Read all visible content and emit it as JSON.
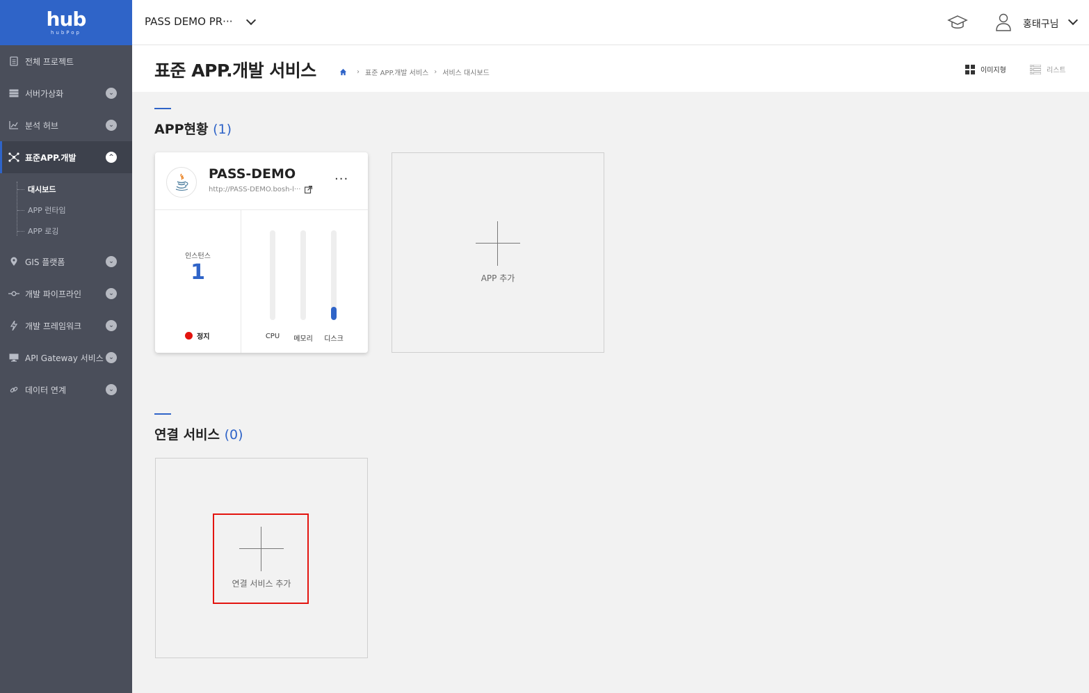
{
  "brand": {
    "logo": "hub",
    "logo_sub": "hubPop",
    "color": "#2f64c8"
  },
  "sidebar": {
    "items": [
      {
        "label": "전체 프로젝트",
        "icon": "document-icon",
        "expandable": false
      },
      {
        "label": "서버가상화",
        "icon": "server-icon",
        "expandable": true
      },
      {
        "label": "분석 허브",
        "icon": "chart-icon",
        "expandable": true
      },
      {
        "label": "표준APP.개발",
        "icon": "network-icon",
        "expandable": true,
        "active": true
      },
      {
        "label": "GIS 플랫폼",
        "icon": "map-pin-icon",
        "expandable": true
      },
      {
        "label": "개발 파이프라인",
        "icon": "pipeline-icon",
        "expandable": true
      },
      {
        "label": "개발 프레임워크",
        "icon": "lightning-icon",
        "expandable": true
      },
      {
        "label": "API Gateway 서비스",
        "icon": "monitor-icon",
        "expandable": true
      },
      {
        "label": "데이터 연계",
        "icon": "link-icon",
        "expandable": true
      }
    ],
    "subitems": [
      {
        "label": "대시보드",
        "active": true
      },
      {
        "label": "APP 런타임"
      },
      {
        "label": "APP 로깅"
      }
    ]
  },
  "topbar": {
    "project": "PASS DEMO PR···",
    "user_name": "홍태구님"
  },
  "titlebar": {
    "title": "표준 APP.개발 서비스",
    "breadcrumb": [
      "표준 APP.개발 서비스",
      "서비스 대시보드"
    ],
    "view_image": "이미지형",
    "view_list": "리스트"
  },
  "app_section": {
    "title": "APP현황",
    "count": "(1)",
    "app": {
      "name": "PASS-DEMO",
      "url": "http://PASS-DEMO.bosh-l···",
      "instance_label": "인스턴스",
      "instances": "1",
      "status": "정지",
      "status_color": "#e3140f",
      "gauges": [
        {
          "label": "CPU",
          "level": 0
        },
        {
          "label": "메모리",
          "level": 0
        },
        {
          "label": "디스크",
          "level": 0.15
        }
      ]
    },
    "add_label": "APP 추가"
  },
  "service_section": {
    "title": "연결 서비스",
    "count": "(0)",
    "add_label": "연결 서비스 추가"
  }
}
